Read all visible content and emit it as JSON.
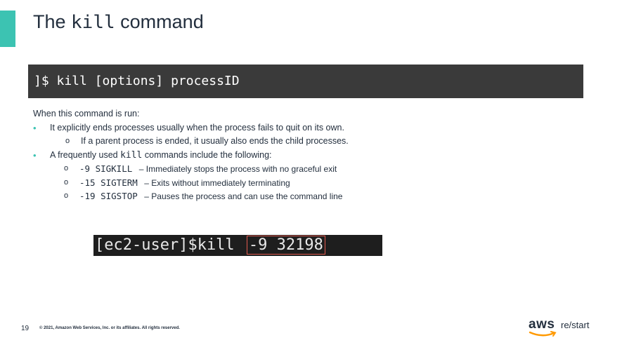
{
  "slide": {
    "title_prefix": "The ",
    "title_code": "kill",
    "title_suffix": " command",
    "command_banner": "]$ kill [options] processID",
    "intro": "When this command is run:",
    "bullet1": "It explicitly ends processes usually when the process fails to quit on its own.",
    "sub1": "If a parent process is ended, it usually also ends the child processes.",
    "bullet2_prefix": "A frequently used ",
    "bullet2_code": "kill",
    "bullet2_suffix": " commands include the following:",
    "signals": [
      {
        "code": "-9 SIGKILL",
        "desc": "– Immediately stops the process with no graceful exit"
      },
      {
        "code": "-15 SIGTERM",
        "desc": "– Exits without immediately terminating"
      },
      {
        "code": "-19 SIGSTOP",
        "desc": "– Pauses the process and can use the command line"
      }
    ],
    "terminal": {
      "prompt": "[ec2-user]$kill ",
      "highlight": "-9 32198"
    }
  },
  "footer": {
    "page_number": "19",
    "copyright": "© 2021, Amazon Web Services, Inc. or its affiliates. All rights reserved.",
    "logo_aws": "aws",
    "logo_restart": "re/start"
  },
  "colors": {
    "accent": "#3cc3b2",
    "banner_bg": "#3a3a3a",
    "highlight_border": "#e05a4f",
    "smile": "#ff9900"
  }
}
